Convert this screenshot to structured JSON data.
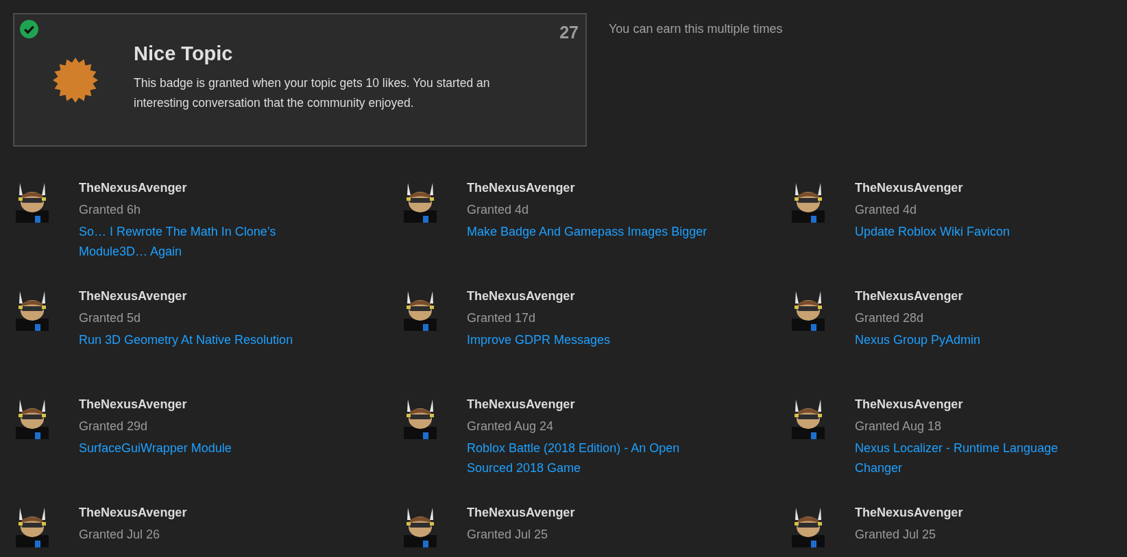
{
  "badge": {
    "title": "Nice Topic",
    "description": "This badge is granted when your topic gets 10 likes. You started an interesting conversation that the community enjoyed.",
    "count": "27",
    "granted": true
  },
  "note": "You can earn this multiple times",
  "grants": [
    {
      "user": "TheNexusAvenger",
      "granted": "Granted 6h",
      "topic": "So… I Rewrote The Math In Clone’s Module3D… Again"
    },
    {
      "user": "TheNexusAvenger",
      "granted": "Granted 4d",
      "topic": "Make Badge And Gamepass Images Bigger"
    },
    {
      "user": "TheNexusAvenger",
      "granted": "Granted 4d",
      "topic": "Update Roblox Wiki Favicon"
    },
    {
      "user": "TheNexusAvenger",
      "granted": "Granted 5d",
      "topic": "Run 3D Geometry At Native Resolution"
    },
    {
      "user": "TheNexusAvenger",
      "granted": "Granted 17d",
      "topic": "Improve GDPR Messages"
    },
    {
      "user": "TheNexusAvenger",
      "granted": "Granted 28d",
      "topic": "Nexus Group PyAdmin"
    },
    {
      "user": "TheNexusAvenger",
      "granted": "Granted 29d",
      "topic": "SurfaceGuiWrapper Module"
    },
    {
      "user": "TheNexusAvenger",
      "granted": "Granted Aug 24",
      "topic": "Roblox Battle (2018 Edition) - An Open Sourced 2018 Game"
    },
    {
      "user": "TheNexusAvenger",
      "granted": "Granted Aug 18",
      "topic": "Nexus Localizer - Runtime Language Changer"
    },
    {
      "user": "TheNexusAvenger",
      "granted": "Granted Jul 26"
    },
    {
      "user": "TheNexusAvenger",
      "granted": "Granted Jul 25"
    },
    {
      "user": "TheNexusAvenger",
      "granted": "Granted Jul 25"
    }
  ]
}
